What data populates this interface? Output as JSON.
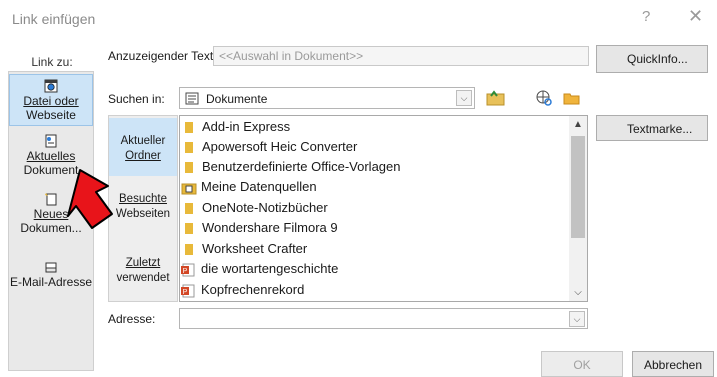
{
  "window": {
    "title": "Link einfügen",
    "help_label": "?",
    "close_label": "✕"
  },
  "link_to": {
    "label": "Link zu:",
    "items": [
      {
        "label_line1": "Datei oder",
        "label_line2": "Webseite",
        "icon": "globe-file-icon",
        "selected": true
      },
      {
        "label_line1": "Aktuelles",
        "label_line2": "Dokument",
        "icon": "document-icon",
        "selected": false
      },
      {
        "label_line1": "Neues",
        "label_line2": "Dokumen...",
        "icon": "new-document-icon",
        "selected": false
      },
      {
        "label_line1": "E-Mail-Adresse",
        "label_line2": "",
        "icon": "email-icon",
        "selected": false
      }
    ]
  },
  "display_text": {
    "label": "Anzuzeigender Text:",
    "value": "<<Auswahl in Dokument>>"
  },
  "buttons": {
    "quickinfo": "QuickInfo...",
    "textmarke": "Textmarke...",
    "ok": "OK",
    "cancel": "Abbrechen"
  },
  "search_in": {
    "label": "Suchen in:",
    "value": "Dokumente"
  },
  "categories": [
    {
      "line1": "Aktueller",
      "line2": "Ordner",
      "selected": true
    },
    {
      "line1": "Besuchte",
      "line2": "Webseiten",
      "selected": false
    },
    {
      "line1": "Zuletzt",
      "line2": "verwendet",
      "selected": false
    }
  ],
  "files": [
    {
      "name": "Add-in Express",
      "type": "folder"
    },
    {
      "name": "Apowersoft Heic Converter",
      "type": "folder"
    },
    {
      "name": "Benutzerdefinierte Office-Vorlagen",
      "type": "folder"
    },
    {
      "name": "Meine Datenquellen",
      "type": "datasource"
    },
    {
      "name": "OneNote-Notizbücher",
      "type": "folder"
    },
    {
      "name": "Wondershare Filmora 9",
      "type": "folder"
    },
    {
      "name": "Worksheet Crafter",
      "type": "folder"
    },
    {
      "name": "die wortartengeschichte",
      "type": "powerpoint"
    },
    {
      "name": "Kopfrechenrekord",
      "type": "powerpoint"
    }
  ],
  "address": {
    "label": "Adresse:",
    "value": ""
  },
  "colors": {
    "selection": "#cde4f7",
    "folder": "#e8b93a",
    "powerpoint": "#d24726",
    "annotation_arrow": "#e8141a"
  }
}
